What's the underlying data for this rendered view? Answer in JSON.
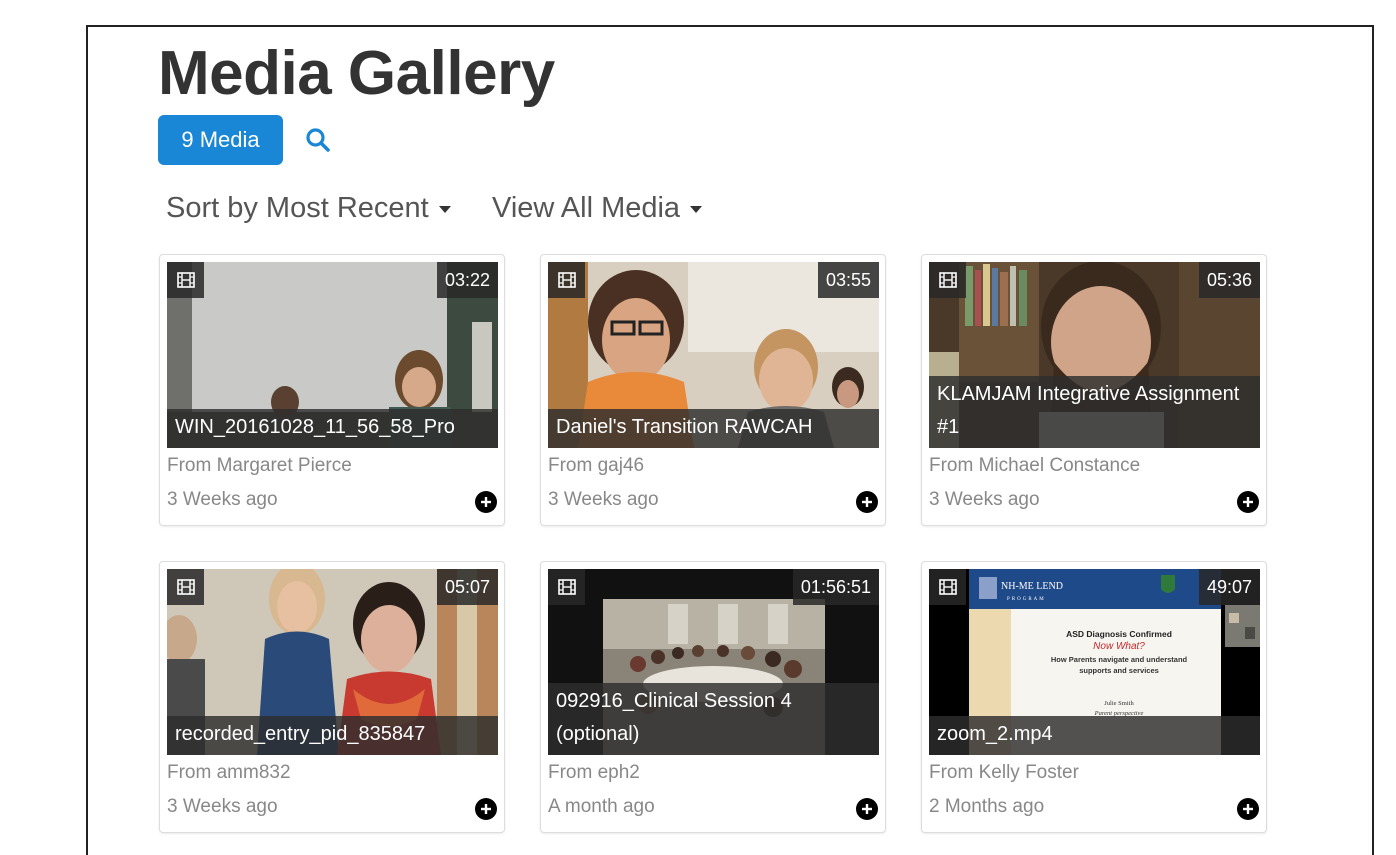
{
  "page": {
    "title": "Media Gallery",
    "media_count_label": "9 Media",
    "sort_label": "Sort by Most Recent",
    "filter_label": "View All Media"
  },
  "colors": {
    "accent": "#1a86d6",
    "title": "#333333",
    "muted": "#888888"
  },
  "icons": {
    "search": "search-icon",
    "media_type": "film-icon",
    "add": "plus-circle-icon",
    "dropdown": "caret-down-icon"
  },
  "cards": [
    {
      "title": "WIN_20161028_11_56_58_Pro",
      "duration": "03:22",
      "author": "From Margaret Pierce",
      "time": "3 Weeks ago"
    },
    {
      "title": "Daniel's Transition RAWCAH",
      "duration": "03:55",
      "author": "From gaj46",
      "time": "3 Weeks ago"
    },
    {
      "title": "KLAMJAM Integrative Assignment #1",
      "duration": "05:36",
      "author": "From Michael Constance",
      "time": "3 Weeks ago"
    },
    {
      "title": "recorded_entry_pid_835847",
      "duration": "05:07",
      "author": "From amm832",
      "time": "3 Weeks ago"
    },
    {
      "title": "092916_Clinical Session 4 (optional)",
      "duration": "01:56:51",
      "author": "From eph2",
      "time": "A month ago"
    },
    {
      "title": "zoom_2.mp4",
      "duration": "49:07",
      "author": "From Kelly Foster",
      "time": "2 Months ago"
    }
  ],
  "slide": {
    "program": "NH-ME LEND",
    "program_sub": "PROGRAM",
    "heading": "ASD Diagnosis Confirmed",
    "subheading": "Now What?",
    "line1": "How Parents navigate and understand",
    "line2": "supports and services",
    "presenter": "Julie Smith",
    "role": "Parent perspective"
  }
}
